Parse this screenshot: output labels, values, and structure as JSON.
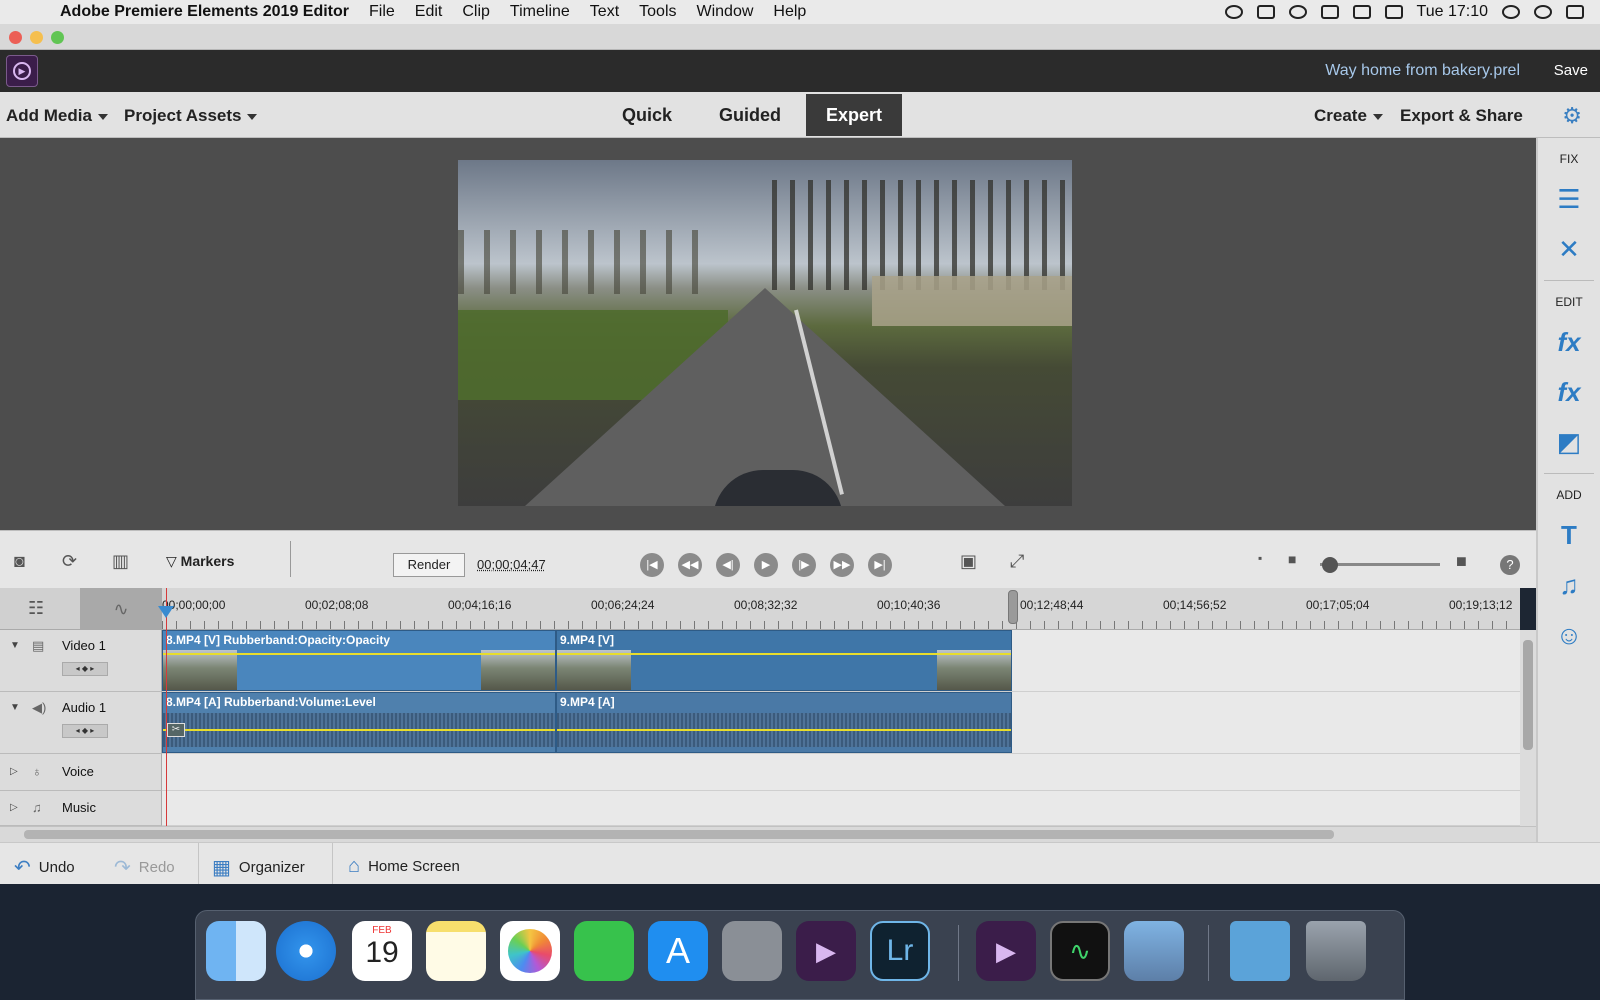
{
  "menubar": {
    "app": "Adobe Premiere Elements 2019 Editor",
    "items": [
      "File",
      "Edit",
      "Clip",
      "Timeline",
      "Text",
      "Tools",
      "Window",
      "Help"
    ],
    "clock": "Tue 17:10"
  },
  "header": {
    "project_name": "Way home from bakery.prel",
    "save_label": "Save"
  },
  "toolbar": {
    "add_media": "Add Media",
    "project_assets": "Project Assets",
    "modes": [
      "Quick",
      "Guided",
      "Expert"
    ],
    "active_mode": "Expert",
    "create": "Create",
    "export_share": "Export & Share"
  },
  "right_panel": {
    "fix_label": "FIX",
    "edit_label": "EDIT",
    "add_label": "ADD",
    "fx_label": "fx"
  },
  "timeline_bar": {
    "markers_label": "Markers",
    "render_label": "Render",
    "timecode": "00;00;04;47"
  },
  "ruler": {
    "ticks": [
      "00;00;00;00",
      "00;02;08;08",
      "00;04;16;16",
      "00;06;24;24",
      "00;08;32;32",
      "00;10;40;36",
      "00;12;48;44",
      "00;14;56;52",
      "00;17;05;04",
      "00;19;13;12"
    ]
  },
  "tracks": {
    "video1": "Video 1",
    "audio1": "Audio 1",
    "voice": "Voice",
    "music": "Music"
  },
  "clips": {
    "video_a": "8.MP4 [V] Rubberband:Opacity:Opacity",
    "video_b": "9.MP4 [V]",
    "audio_a": "8.MP4 [A] Rubberband:Volume:Level",
    "audio_b": "9.MP4 [A]"
  },
  "bottombar": {
    "undo": "Undo",
    "redo": "Redo",
    "organizer": "Organizer",
    "home_screen": "Home Screen"
  },
  "dock": {
    "calendar_month": "FEB",
    "calendar_day": "19",
    "lightroom": "Lr"
  },
  "colors": {
    "accent": "#3a7fc1",
    "clip_blue": "#4a86bd",
    "rubberband": "#e8dd2c",
    "playhead": "#d63a3a"
  }
}
